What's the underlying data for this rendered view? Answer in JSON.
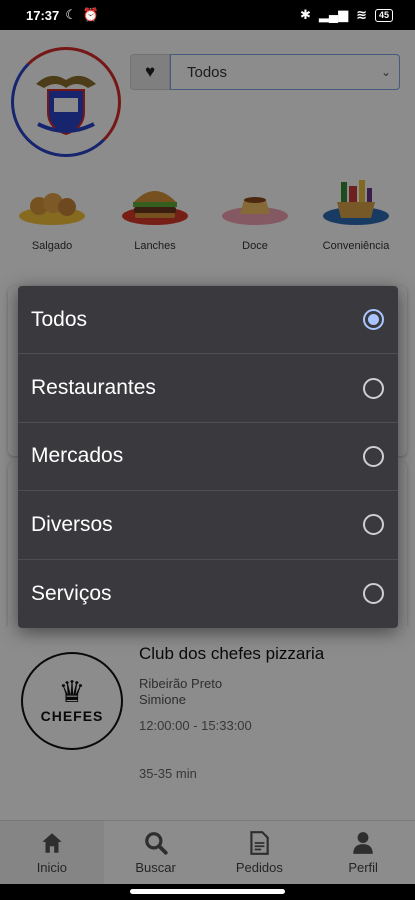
{
  "status_bar": {
    "time": "17:37",
    "battery": "45"
  },
  "header": {
    "favorite_icon": "heart-icon",
    "filter_select": {
      "selected": "Todos"
    }
  },
  "categories": [
    {
      "label": "Salgado",
      "icon": "salgado-image"
    },
    {
      "label": "Lanches",
      "icon": "burger-image"
    },
    {
      "label": "Doce",
      "icon": "dessert-image"
    },
    {
      "label": "Conveniência",
      "icon": "basket-image"
    }
  ],
  "store": {
    "name": "Club dos chefes pizzaria",
    "city": "Ribeirão Preto",
    "district": "Simione",
    "hours": "12:00:00 - 15:33:00",
    "delivery_time": "35-35 min",
    "logo_text": "CHEFES"
  },
  "tabs": [
    {
      "label": "Inicio",
      "icon": "home-icon",
      "active": true
    },
    {
      "label": "Buscar",
      "icon": "search-icon",
      "active": false
    },
    {
      "label": "Pedidos",
      "icon": "document-icon",
      "active": false
    },
    {
      "label": "Perfil",
      "icon": "user-icon",
      "active": false
    }
  ],
  "dialog": {
    "options": [
      {
        "label": "Todos",
        "selected": true
      },
      {
        "label": "Restaurantes",
        "selected": false
      },
      {
        "label": "Mercados",
        "selected": false
      },
      {
        "label": "Diversos",
        "selected": false
      },
      {
        "label": "Serviços",
        "selected": false
      }
    ]
  },
  "colors": {
    "accent": "#a9c4ff",
    "dialog_bg": "#3a3a3e",
    "select_border": "#7aa6e8"
  }
}
